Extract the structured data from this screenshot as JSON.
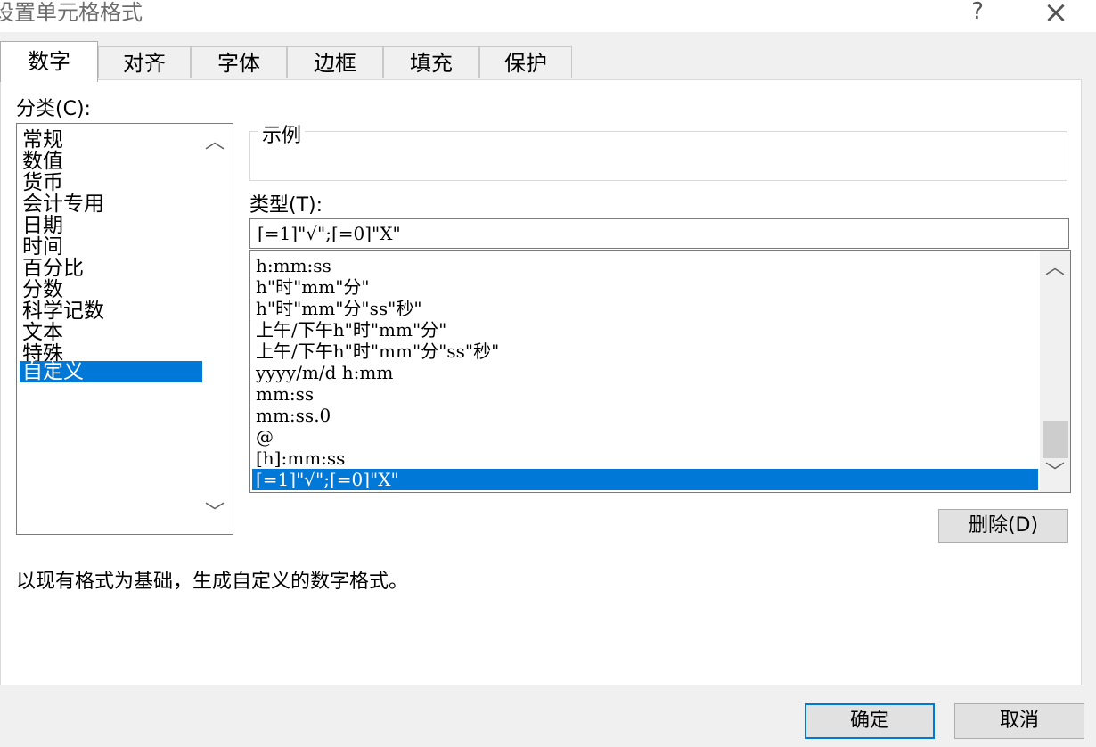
{
  "window": {
    "title": "设置单元格格式",
    "help": "?",
    "close": "×"
  },
  "tabs": [
    {
      "label": "数字",
      "active": true
    },
    {
      "label": "对齐"
    },
    {
      "label": "字体"
    },
    {
      "label": "边框"
    },
    {
      "label": "填充"
    },
    {
      "label": "保护"
    }
  ],
  "category": {
    "label": "分类(C):",
    "items": [
      "常规",
      "数值",
      "货币",
      "会计专用",
      "日期",
      "时间",
      "百分比",
      "分数",
      "科学记数",
      "文本",
      "特殊",
      "自定义"
    ],
    "selected": "自定义"
  },
  "sample": {
    "label": "示例"
  },
  "type": {
    "label": "类型(T):",
    "value": "[=1]\"√\";[=0]\"X\"",
    "list": [
      "h:mm:ss",
      "h\"时\"mm\"分\"",
      "h\"时\"mm\"分\"ss\"秒\"",
      "上午/下午h\"时\"mm\"分\"",
      "上午/下午h\"时\"mm\"分\"ss\"秒\"",
      "yyyy/m/d h:mm",
      "mm:ss",
      "mm:ss.0",
      "@",
      "[h]:mm:ss",
      "[=1]\"√\";[=0]\"X\""
    ],
    "selected": "[=1]\"√\";[=0]\"X\""
  },
  "buttons": {
    "delete": "删除(D)",
    "ok": "确定",
    "cancel": "取消"
  },
  "hint": "以现有格式为基础，生成自定义的数字格式。",
  "colors": {
    "selection": "#0078d7",
    "default_button_border": "#0078d7",
    "dialog_bg": "#f0f0f0"
  },
  "icons": {
    "help": "question-icon",
    "close": "close-icon",
    "scroll_up": "chevron-up-icon",
    "scroll_down": "chevron-down-icon"
  }
}
